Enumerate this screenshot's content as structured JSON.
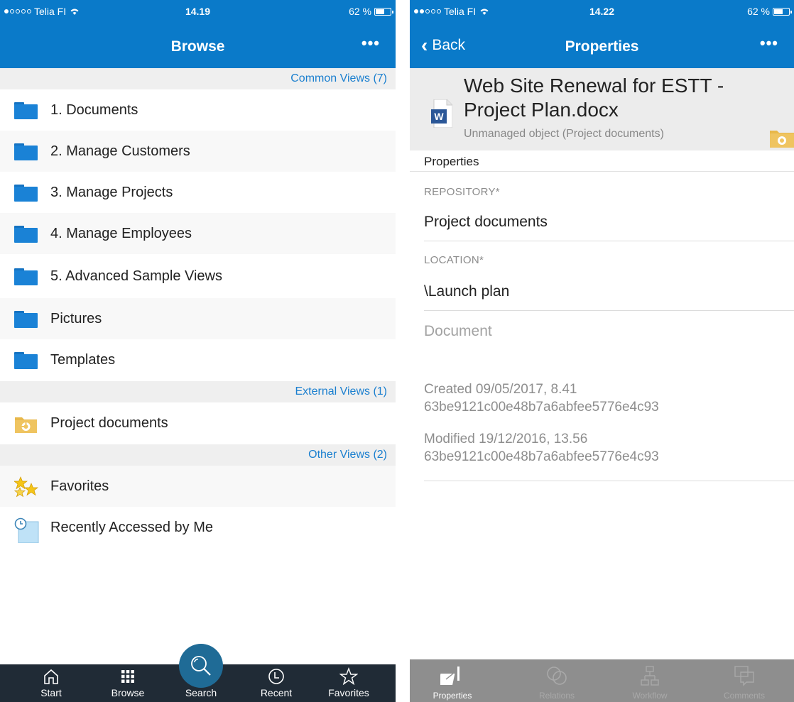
{
  "colors": {
    "accent": "#0a7ac9",
    "section_text": "#1a7fcf",
    "tabbar_dark": "#202b36",
    "tabbar_gray": "#8e8e8e",
    "folder": "#1a82d6"
  },
  "left": {
    "status": {
      "carrier": "Telia FI",
      "time": "14.19",
      "battery": "62 %",
      "battery_level": 0.62
    },
    "nav": {
      "title": "Browse",
      "more_icon": "more-dots-icon"
    },
    "sections": [
      {
        "header": "Common Views (7)",
        "items": [
          {
            "label": "1. Documents",
            "icon": "folder-icon"
          },
          {
            "label": "2. Manage Customers",
            "icon": "folder-icon"
          },
          {
            "label": "3. Manage Projects",
            "icon": "folder-icon"
          },
          {
            "label": "4. Manage Employees",
            "icon": "folder-icon"
          },
          {
            "label": "5. Advanced Sample Views",
            "icon": "folder-icon"
          },
          {
            "label": "Pictures",
            "icon": "folder-icon"
          },
          {
            "label": "Templates",
            "icon": "folder-icon"
          }
        ]
      },
      {
        "header": "External Views (1)",
        "items": [
          {
            "label": "Project documents",
            "icon": "external-vault-icon"
          }
        ]
      },
      {
        "header": "Other Views (2)",
        "items": [
          {
            "label": "Favorites",
            "icon": "stars-icon"
          },
          {
            "label": "Recently Accessed by Me",
            "icon": "clock-document-icon"
          }
        ]
      }
    ],
    "tabbar": [
      {
        "label": "Start",
        "icon": "home-icon"
      },
      {
        "label": "Browse",
        "icon": "grid-icon"
      },
      {
        "label": "Search",
        "icon": "search-icon"
      },
      {
        "label": "Recent",
        "icon": "clock-icon"
      },
      {
        "label": "Favorites",
        "icon": "star-icon"
      }
    ]
  },
  "right": {
    "status": {
      "carrier": "Telia FI",
      "time": "14.22",
      "battery": "62 %",
      "battery_level": 0.62
    },
    "nav": {
      "back": "Back",
      "title": "Properties",
      "more_icon": "more-dots-icon"
    },
    "document": {
      "title_line1": "Web Site Renewal for ESTT -",
      "title_line2": "Project Plan.docx",
      "subtitle": "Unmanaged object (Project documents)",
      "icon": "word-document-icon",
      "badge_icon": "external-vault-icon"
    },
    "properties_label": "Properties",
    "fields": [
      {
        "label": "REPOSITORY*",
        "value": "Project documents"
      },
      {
        "label": "LOCATION*",
        "value": "\\Launch plan"
      }
    ],
    "class_placeholder": "Document",
    "created": {
      "line1": "Created 09/05/2017, 8.41",
      "line2": "63be9121c00e48b7a6abfee5776e4c93"
    },
    "modified": {
      "line1": "Modified 19/12/2016, 13.56",
      "line2": "63be9121c00e48b7a6abfee5776e4c93"
    },
    "tabbar": [
      {
        "label": "Properties",
        "icon": "properties-icon",
        "active": true
      },
      {
        "label": "Relations",
        "icon": "relations-icon",
        "active": false
      },
      {
        "label": "Workflow",
        "icon": "workflow-icon",
        "active": false
      },
      {
        "label": "Comments",
        "icon": "comments-icon",
        "active": false
      }
    ]
  }
}
